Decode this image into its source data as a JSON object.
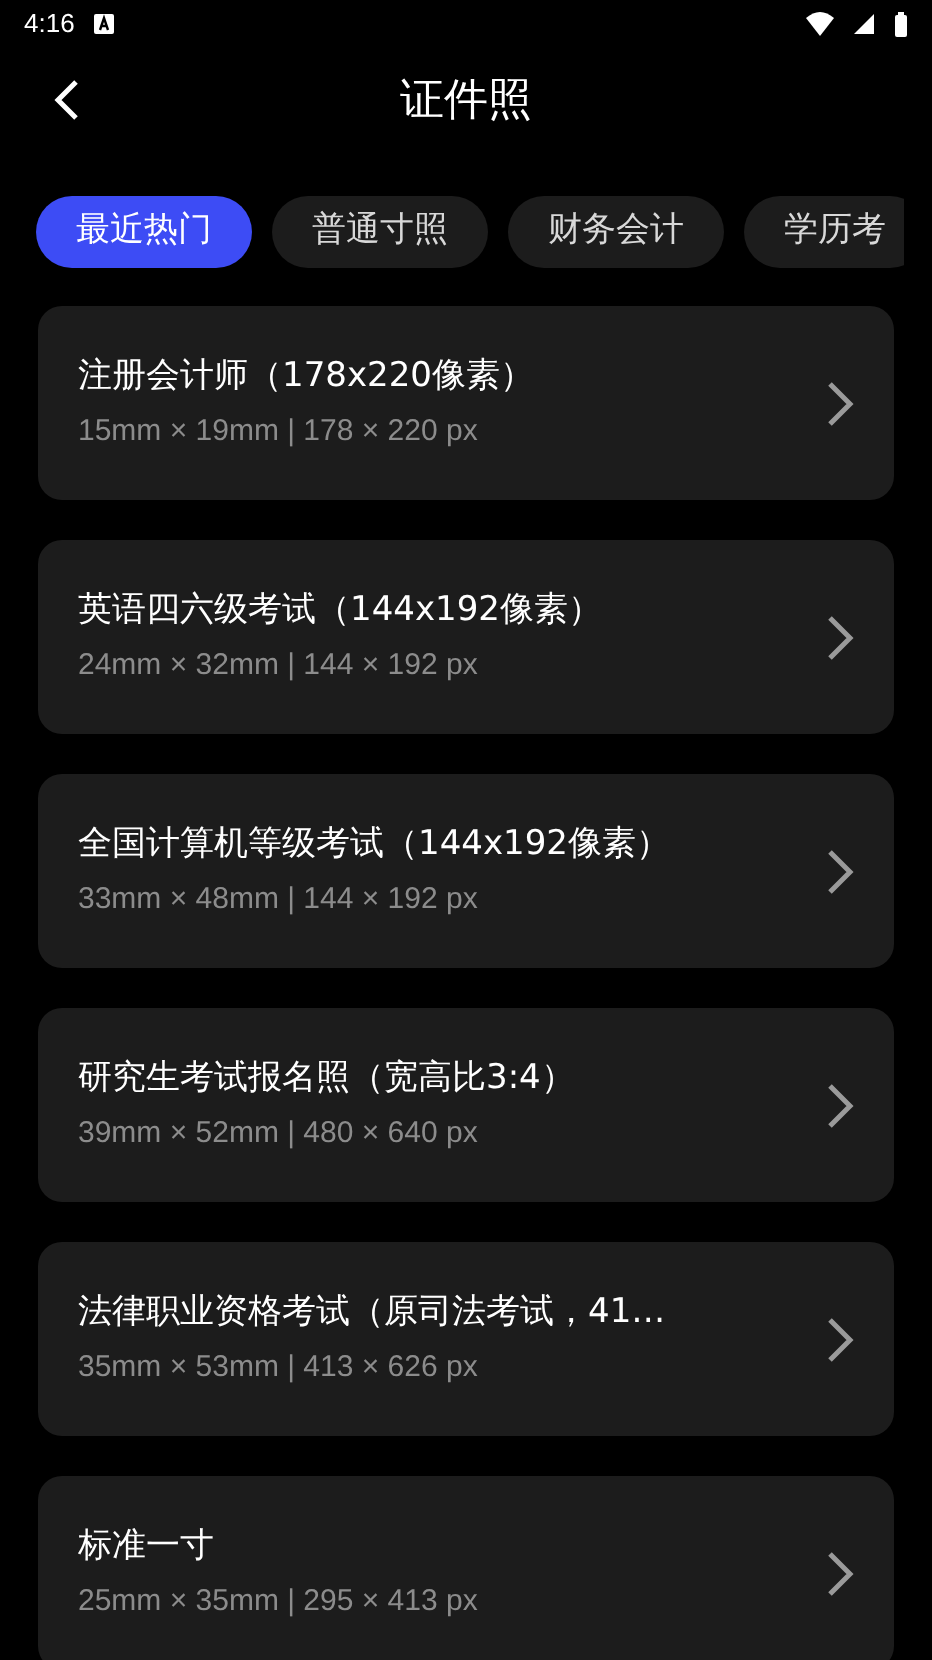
{
  "status_bar": {
    "time": "4:16"
  },
  "header": {
    "title": "证件照"
  },
  "tabs": [
    {
      "label": "最近热门",
      "selected": true
    },
    {
      "label": "普通寸照",
      "selected": false
    },
    {
      "label": "财务会计",
      "selected": false
    },
    {
      "label": "学历考",
      "selected": false
    }
  ],
  "items": [
    {
      "title": "注册会计师（178x220像素）",
      "size": "15mm × 19mm | 178 × 220 px"
    },
    {
      "title": "英语四六级考试（144x192像素）",
      "size": "24mm × 32mm | 144 × 192 px"
    },
    {
      "title": "全国计算机等级考试（144x192像素）",
      "size": "33mm × 48mm | 144 × 192 px"
    },
    {
      "title": "研究生考试报名照（宽高比3:4）",
      "size": "39mm × 52mm | 480 × 640 px"
    },
    {
      "title": "法律职业资格考试（原司法考试，41…",
      "size": "35mm × 53mm | 413 × 626 px"
    },
    {
      "title": "标准一寸",
      "size": "25mm × 35mm | 295 × 413 px"
    }
  ]
}
